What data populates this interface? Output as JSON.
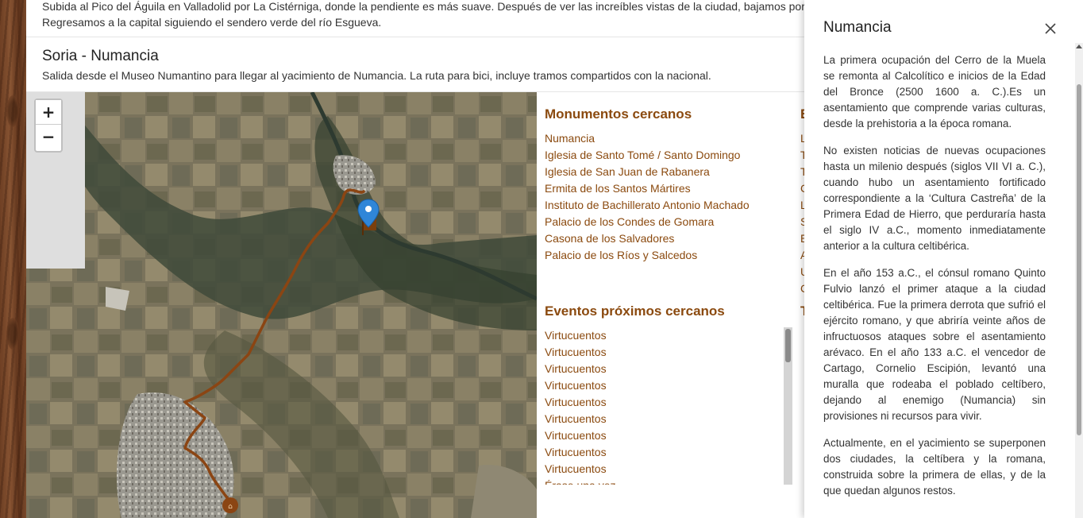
{
  "previous_route": {
    "description_line1": "Subida al Pico del Águila en Valladolid por La Cistérniga, donde la pendiente es más suave. Después de ver las increíbles vistas de la ciudad, bajamos por la z",
    "description_line2": "Regresamos a la capital siguiendo el sendero verde del río Esgueva."
  },
  "route": {
    "title": "Soria - Numancia",
    "description": "Salida desde el Museo Numantino para llegar al yacimiento de Numancia. La ruta para bici, incluye tramos compartidos con la nacional."
  },
  "map": {
    "zoom_in": "+",
    "zoom_out": "−"
  },
  "monuments": {
    "heading": "Monumentos cercanos",
    "items": [
      "Numancia",
      "Iglesia de Santo Tomé / Santo Domingo",
      "Iglesia de San Juan de Rabanera",
      "Ermita de los Santos Mártires",
      "Instituto de Bachillerato Antonio Machado",
      "Palacio de los Condes de Gomara",
      "Casona de los Salvadores",
      "Palacio de los Ríos y Salcedos"
    ]
  },
  "events": {
    "heading": "Eventos próximos cercanos",
    "items": [
      "Virtucuentos",
      "Virtucuentos",
      "Virtucuentos",
      "Virtucuentos",
      "Virtucuentos",
      "Virtucuentos",
      "Virtucuentos",
      "Virtucuentos",
      "Virtucuentos",
      "Érase una vez"
    ]
  },
  "third_column": {
    "heading_partial": "E",
    "items_partial": [
      "L",
      "T",
      "T",
      "C",
      "L",
      "S",
      "E",
      "A",
      "U",
      "C"
    ],
    "heading2_partial": "T"
  },
  "panel": {
    "title": "Numancia",
    "paragraphs": [
      "La primera ocupación del Cerro de la Muela se remonta al Calcolítico e inicios de la Edad del Bronce (2500 1600 a. C.).Es un asentamiento que comprende varias culturas, desde la prehistoria a la época romana.",
      "No existen noticias de nuevas ocupaciones hasta un milenio después (siglos VII VI a. C.), cuando hubo un asentamiento fortificado correspondiente a la ‘Cultura Castreña’ de la Primera Edad de Hierro, que perduraría hasta el siglo IV a.C., momento inmediatamente anterior a la cultura celtibérica.",
      "En el año 153 a.C., el cónsul romano Quinto Fulvio lanzó el primer ataque a la ciudad celtibérica. Fue la primera derrota que sufrió el ejército romano, y que abriría veinte años de infructuosos ataques sobre el asentamiento arévaco. En el año 133 a.C. el vencedor de Cartago, Cornelio Escipión, levantó una muralla que rodeaba el poblado celtíbero, dejando al enemigo (Numancia) sin provisiones ni recursos para vivir.",
      "Actualmente, en el yacimiento se superponen dos ciudades, la celtíbera y la romana, construida sobre la primera de ellas, y de la que quedan algunos restos."
    ]
  },
  "colors": {
    "accent": "#8b4a0f",
    "route_line": "#8b4513",
    "marker_blue": "#2f86d8"
  },
  "icons": [
    "close-icon",
    "map-marker-icon",
    "flag-icon",
    "route-start-icon"
  ]
}
